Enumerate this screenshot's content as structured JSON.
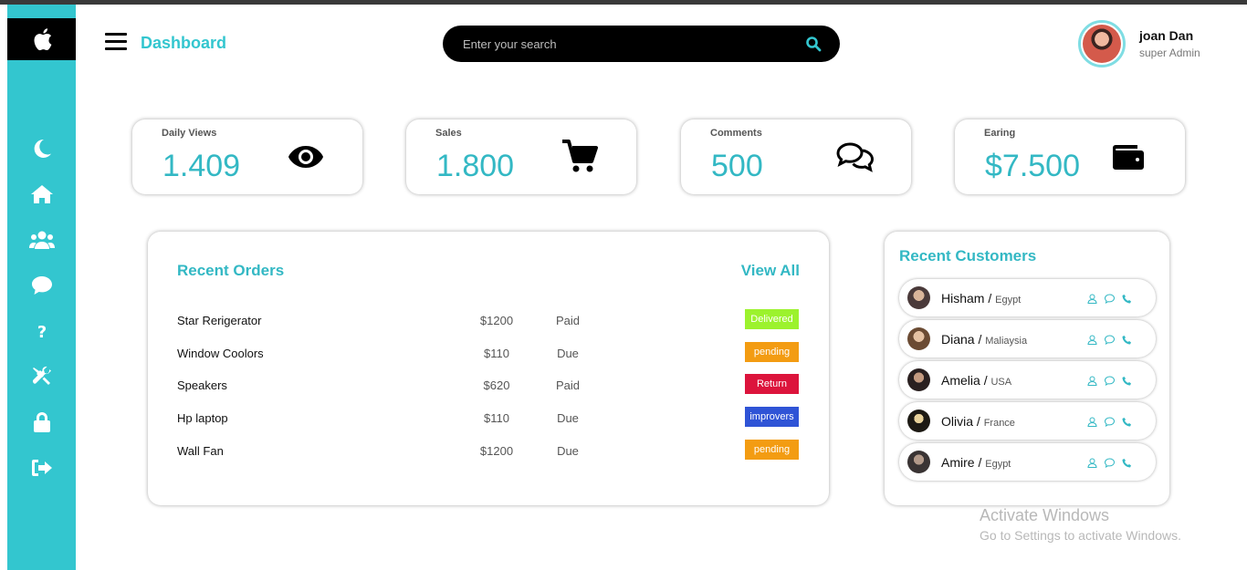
{
  "header": {
    "title": "Dashboard",
    "search_placeholder": "Enter your search",
    "user_name": "joan Dan",
    "user_role": "super Admin"
  },
  "sidebar": {
    "items": [
      {
        "icon": "moon-icon"
      },
      {
        "icon": "home-icon"
      },
      {
        "icon": "users-icon"
      },
      {
        "icon": "comment-icon"
      },
      {
        "icon": "question-icon"
      },
      {
        "icon": "tools-icon"
      },
      {
        "icon": "lock-icon"
      },
      {
        "icon": "sign-out-icon"
      }
    ]
  },
  "cards": [
    {
      "label": "Daily Views",
      "value": "1.409",
      "icon": "eye-icon"
    },
    {
      "label": "Sales",
      "value": "1.800",
      "icon": "cart-icon"
    },
    {
      "label": "Comments",
      "value": "500",
      "icon": "comments-icon"
    },
    {
      "label": "Earing",
      "value": "$7.500",
      "icon": "wallet-icon"
    }
  ],
  "orders": {
    "title": "Recent Orders",
    "view_all": "View All",
    "rows": [
      {
        "name": "Star Rerigerator",
        "price": "$1200",
        "payment": "Paid",
        "status": "Delivered",
        "status_color": "#9cf22d"
      },
      {
        "name": "Window Coolors",
        "price": "$110",
        "payment": "Due",
        "status": "pending",
        "status_color": "#f39c12"
      },
      {
        "name": "Speakers",
        "price": "$620",
        "payment": "Paid",
        "status": "Return",
        "status_color": "#dc143c"
      },
      {
        "name": "Hp laptop",
        "price": "$110",
        "payment": "Due",
        "status": "improvers",
        "status_color": "#2f54d6"
      },
      {
        "name": "Wall Fan",
        "price": "$1200",
        "payment": "Due",
        "status": "pending",
        "status_color": "#f39c12"
      }
    ]
  },
  "customers": {
    "title": "Recent Customers",
    "rows": [
      {
        "name": "Hisham",
        "country": "Egypt"
      },
      {
        "name": "Diana",
        "country": "Maliaysia"
      },
      {
        "name": "Amelia",
        "country": "USA"
      },
      {
        "name": "Olivia",
        "country": "France"
      },
      {
        "name": "Amire",
        "country": "Egypt"
      }
    ]
  },
  "watermark": {
    "line1": "Activate Windows",
    "line2": "Go to Settings to activate Windows."
  },
  "colors": {
    "accent": "#33c6cf",
    "text_accent": "#33b8c4"
  }
}
